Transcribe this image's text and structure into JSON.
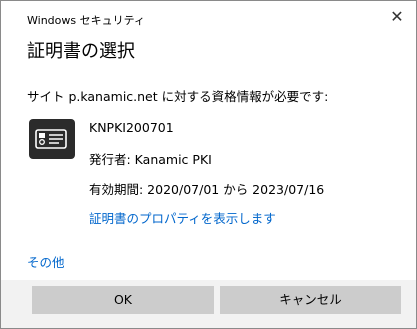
{
  "window": {
    "caption": "Windows セキュリティ",
    "close_glyph": "✕"
  },
  "dialog": {
    "title": "証明書の選択",
    "message": "サイト p.kanamic.net に対する資格情報が必要です:"
  },
  "certificate": {
    "icon": "certificate-icon",
    "name": "KNPKI200701",
    "issuer": "発行者: Kanamic PKI",
    "validity": "有効期間: 2020/07/01 から 2023/07/16",
    "properties_link": "証明書のプロパティを表示します"
  },
  "more_options": "その他",
  "buttons": {
    "ok": "OK",
    "cancel": "キャンセル"
  },
  "colors": {
    "link": "#0066cc",
    "button": "#cccccc",
    "footer": "#f2f2f2",
    "icon": "#2b2b2b"
  }
}
